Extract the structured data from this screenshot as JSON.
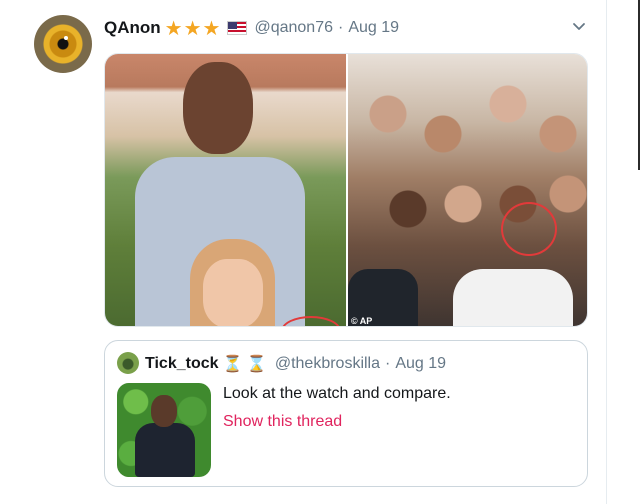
{
  "tweet": {
    "author_name": "QAnon",
    "name_badges": "★★★",
    "handle": "@qanon76",
    "separator": "·",
    "date": "Aug 19",
    "media_credit": "© AP"
  },
  "quoted_tweet": {
    "author_name": "Tick_tock",
    "name_badges": "⏳ ⌛",
    "handle": "@thekbroskilla",
    "separator": "·",
    "date": "Aug 19",
    "text": "Look at the watch and compare.",
    "link": "Show this thread"
  },
  "icons": {
    "menu": "chevron-down-icon",
    "flag": "us-flag-icon"
  },
  "colors": {
    "secondary_text": "#657786",
    "link": "#e0245e",
    "star": "#f4a623",
    "highlight_circle": "#e23a3a"
  }
}
